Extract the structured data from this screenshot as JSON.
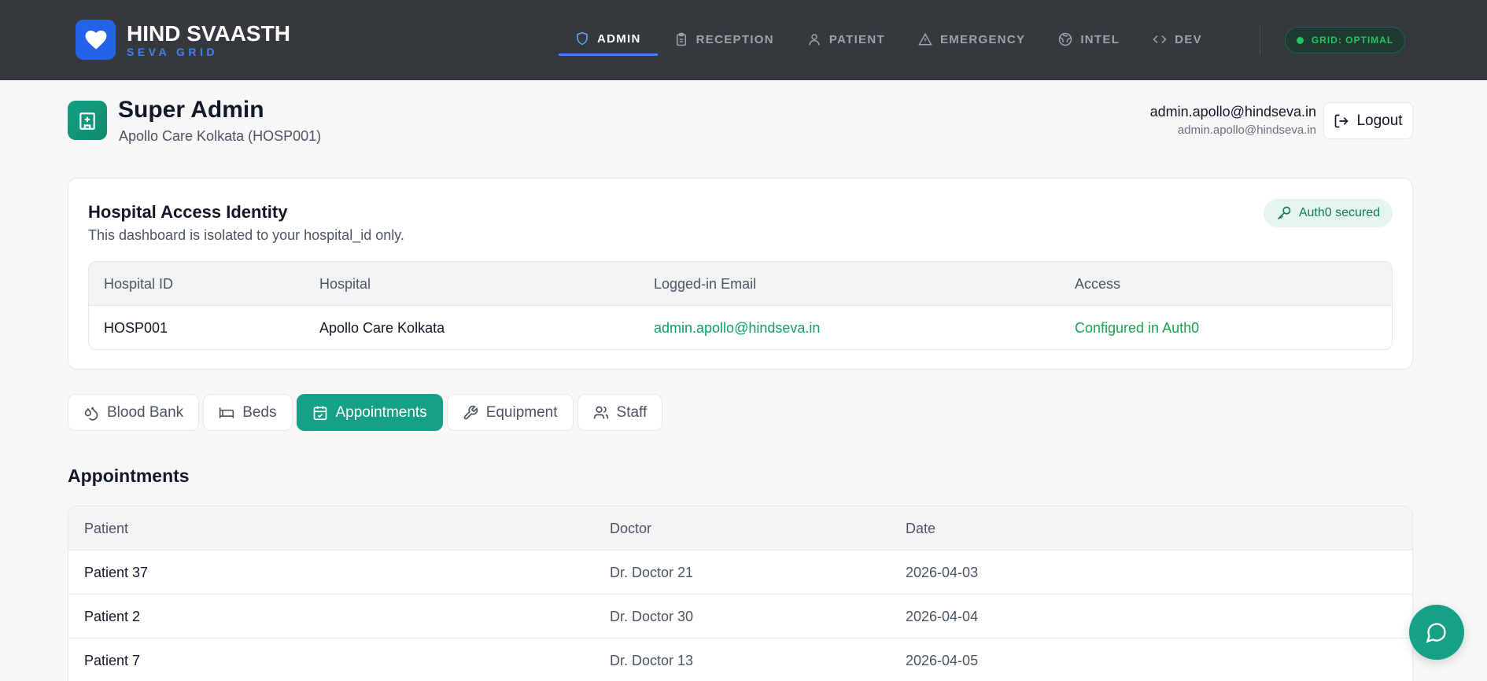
{
  "brand": {
    "title": "HIND SVAASTH",
    "subtitle": "SEVA GRID"
  },
  "nav": [
    {
      "label": "ADMIN",
      "icon": "shield-icon",
      "active": true
    },
    {
      "label": "RECEPTION",
      "icon": "clipboard-icon"
    },
    {
      "label": "PATIENT",
      "icon": "user-icon"
    },
    {
      "label": "EMERGENCY",
      "icon": "alert-triangle-icon"
    },
    {
      "label": "INTEL",
      "icon": "globe-icon"
    },
    {
      "label": "DEV",
      "icon": "code-icon"
    }
  ],
  "status": {
    "label": "GRID: OPTIMAL",
    "color": "#22c55e"
  },
  "header": {
    "title": "Super Admin",
    "subtitle": "Apollo Care Kolkata (HOSP001)",
    "email": "admin.apollo@hindseva.in",
    "email_secondary": "admin.apollo@hindseva.in",
    "logout_label": "Logout"
  },
  "identity": {
    "title": "Hospital Access Identity",
    "subtitle": "This dashboard is isolated to your hospital_id only.",
    "badge": "Auth0 secured",
    "columns": [
      "Hospital ID",
      "Hospital",
      "Logged-in Email",
      "Access"
    ],
    "row": [
      "HOSP001",
      "Apollo Care Kolkata",
      "admin.apollo@hindseva.in",
      "Configured in Auth0"
    ]
  },
  "tabs": [
    {
      "label": "Blood Bank",
      "icon": "droplet-icon"
    },
    {
      "label": "Beds",
      "icon": "bed-icon"
    },
    {
      "label": "Appointments",
      "icon": "calendar-check-icon",
      "active": true
    },
    {
      "label": "Equipment",
      "icon": "wrench-icon"
    },
    {
      "label": "Staff",
      "icon": "users-icon"
    }
  ],
  "appointments": {
    "title": "Appointments",
    "columns": [
      "Patient",
      "Doctor",
      "Date"
    ],
    "rows": [
      [
        "Patient 37",
        "Dr. Doctor 21",
        "2026-04-03"
      ],
      [
        "Patient 2",
        "Dr. Doctor 30",
        "2026-04-04"
      ],
      [
        "Patient 7",
        "Dr. Doctor 13",
        "2026-04-05"
      ]
    ]
  },
  "colors": {
    "accent": "#16a085",
    "nav_bg": "#35393d",
    "brand_blue": "#2563eb"
  }
}
